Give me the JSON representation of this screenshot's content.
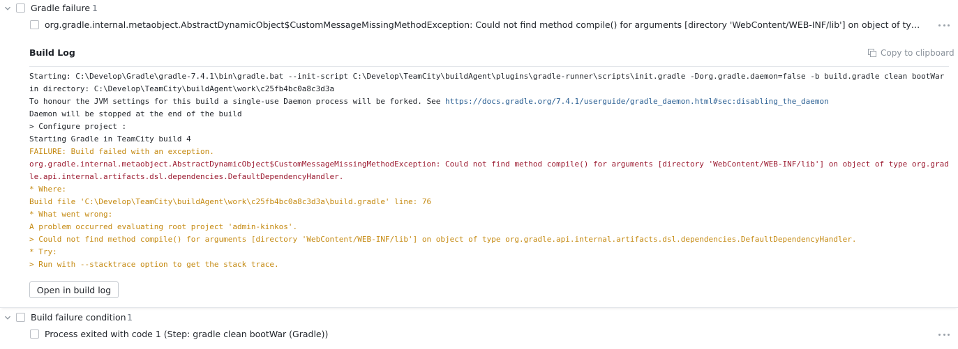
{
  "group1": {
    "title": "Gradle failure",
    "count": "1",
    "problem": "org.gradle.internal.metaobject.AbstractDynamicObject$CustomMessageMissingMethodException: Could not find method compile() for arguments [directory 'WebContent/WEB-INF/lib'] on object of type org.gradl…"
  },
  "build_log": {
    "title": "Build Log",
    "copy_label": "Copy to clipboard",
    "open_label": "Open in build log",
    "lines": [
      {
        "segments": [
          {
            "text": "Starting: C:\\Develop\\Gradle\\gradle-7.4.1\\bin\\gradle.bat --init-script C:\\Develop\\TeamCity\\buildAgent\\plugins\\gradle-runner\\scripts\\init.gradle -Dorg.gradle.daemon=false -b build.gradle clean bootWar",
            "style": "default"
          }
        ]
      },
      {
        "segments": [
          {
            "text": "in directory: C:\\Develop\\TeamCity\\buildAgent\\work\\c25fb4bc0a8c3d3a",
            "style": "default"
          }
        ]
      },
      {
        "segments": [
          {
            "text": "To honour the JVM settings for this build a single-use Daemon process will be forked. See ",
            "style": "default"
          },
          {
            "text": "https://docs.gradle.org/7.4.1/userguide/gradle_daemon.html#sec:disabling_the_daemon",
            "style": "link"
          }
        ]
      },
      {
        "segments": [
          {
            "text": "Daemon will be stopped at the end of the build",
            "style": "default"
          }
        ]
      },
      {
        "segments": [
          {
            "text": "> Configure project :",
            "style": "default"
          }
        ]
      },
      {
        "segments": [
          {
            "text": "Starting Gradle in TeamCity build 4",
            "style": "default"
          }
        ]
      },
      {
        "segments": [
          {
            "text": "FAILURE: Build failed with an exception.",
            "style": "warn"
          }
        ]
      },
      {
        "segments": [
          {
            "text": "org.gradle.internal.metaobject.AbstractDynamicObject$CustomMessageMissingMethodException: Could not find method compile() for arguments [directory 'WebContent/WEB-INF/lib'] on object of type org.grad",
            "style": "error"
          }
        ]
      },
      {
        "segments": [
          {
            "text": "le.api.internal.artifacts.dsl.dependencies.DefaultDependencyHandler.",
            "style": "error"
          }
        ]
      },
      {
        "segments": [
          {
            "text": "* Where:",
            "style": "warn"
          }
        ]
      },
      {
        "segments": [
          {
            "text": "Build file 'C:\\Develop\\TeamCity\\buildAgent\\work\\c25fb4bc0a8c3d3a\\build.gradle' line: 76",
            "style": "warn"
          }
        ]
      },
      {
        "segments": [
          {
            "text": "* What went wrong:",
            "style": "warn"
          }
        ]
      },
      {
        "segments": [
          {
            "text": "A problem occurred evaluating root project 'admin-kinkos'.",
            "style": "warn"
          }
        ]
      },
      {
        "segments": [
          {
            "text": "> Could not find method compile() for arguments [directory 'WebContent/WEB-INF/lib'] on object of type org.gradle.api.internal.artifacts.dsl.dependencies.DefaultDependencyHandler.",
            "style": "warn"
          }
        ]
      },
      {
        "segments": [
          {
            "text": "* Try:",
            "style": "warn"
          }
        ]
      },
      {
        "segments": [
          {
            "text": "> Run with --stacktrace option to get the stack trace.",
            "style": "warn"
          }
        ]
      }
    ]
  },
  "group2": {
    "title": "Build failure condition",
    "count": "1",
    "problem": "Process exited with code 1 (Step: gradle clean bootWar (Gradle))"
  },
  "icons": [
    "chevron-down-icon",
    "checkbox-icon",
    "copy-icon",
    "more-icon"
  ],
  "colors": {
    "error": "#9c1c32",
    "warn": "#c58a12",
    "link": "#2a5f93",
    "text": "#1f2329"
  }
}
